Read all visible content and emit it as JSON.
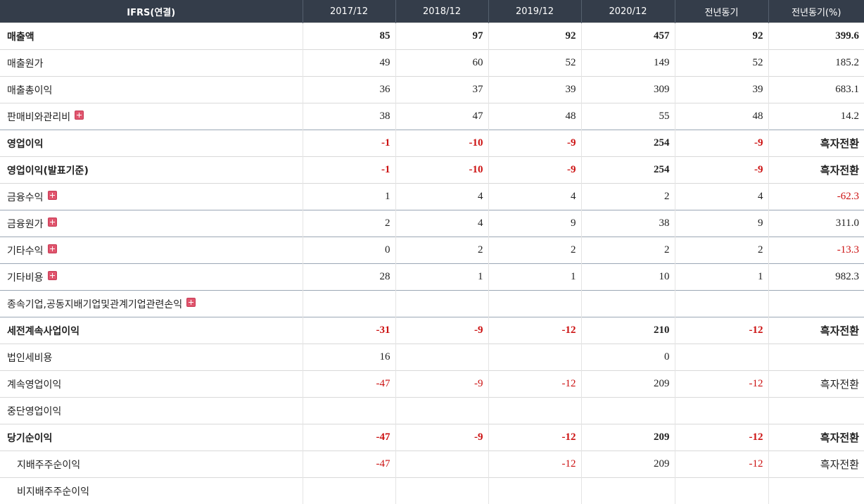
{
  "table": {
    "headers": [
      "IFRS(연결)",
      "2017/12",
      "2018/12",
      "2019/12",
      "2020/12",
      "전년동기",
      "전년동기(%)"
    ],
    "rows": [
      {
        "label": "매출액",
        "bold": true,
        "sub": false,
        "sep": false,
        "expand": false,
        "cells": [
          {
            "v": "85",
            "neg": false
          },
          {
            "v": "97",
            "neg": false
          },
          {
            "v": "92",
            "neg": false
          },
          {
            "v": "457",
            "neg": false
          },
          {
            "v": "92",
            "neg": false
          },
          {
            "v": "399.6",
            "neg": false
          }
        ]
      },
      {
        "label": "매출원가",
        "bold": false,
        "sub": false,
        "sep": false,
        "expand": false,
        "cells": [
          {
            "v": "49",
            "neg": false
          },
          {
            "v": "60",
            "neg": false
          },
          {
            "v": "52",
            "neg": false
          },
          {
            "v": "149",
            "neg": false
          },
          {
            "v": "52",
            "neg": false
          },
          {
            "v": "185.2",
            "neg": false
          }
        ]
      },
      {
        "label": "매출총이익",
        "bold": false,
        "sub": false,
        "sep": false,
        "expand": false,
        "cells": [
          {
            "v": "36",
            "neg": false
          },
          {
            "v": "37",
            "neg": false
          },
          {
            "v": "39",
            "neg": false
          },
          {
            "v": "309",
            "neg": false
          },
          {
            "v": "39",
            "neg": false
          },
          {
            "v": "683.1",
            "neg": false
          }
        ]
      },
      {
        "label": "판매비와관리비",
        "bold": false,
        "sub": false,
        "sep": false,
        "expand": true,
        "cells": [
          {
            "v": "38",
            "neg": false
          },
          {
            "v": "47",
            "neg": false
          },
          {
            "v": "48",
            "neg": false
          },
          {
            "v": "55",
            "neg": false
          },
          {
            "v": "48",
            "neg": false
          },
          {
            "v": "14.2",
            "neg": false
          }
        ]
      },
      {
        "label": "영업이익",
        "bold": true,
        "sub": false,
        "sep": true,
        "expand": false,
        "cells": [
          {
            "v": "-1",
            "neg": true
          },
          {
            "v": "-10",
            "neg": true
          },
          {
            "v": "-9",
            "neg": true
          },
          {
            "v": "254",
            "neg": false
          },
          {
            "v": "-9",
            "neg": true
          },
          {
            "v": "흑자전환",
            "neg": false
          }
        ]
      },
      {
        "label": "영업이익(발표기준)",
        "bold": true,
        "sub": false,
        "sep": false,
        "expand": false,
        "cells": [
          {
            "v": "-1",
            "neg": true
          },
          {
            "v": "-10",
            "neg": true
          },
          {
            "v": "-9",
            "neg": true
          },
          {
            "v": "254",
            "neg": false
          },
          {
            "v": "-9",
            "neg": true
          },
          {
            "v": "흑자전환",
            "neg": false
          }
        ]
      },
      {
        "label": "금융수익",
        "bold": false,
        "sub": false,
        "sep": false,
        "expand": true,
        "cells": [
          {
            "v": "1",
            "neg": false
          },
          {
            "v": "4",
            "neg": false
          },
          {
            "v": "4",
            "neg": false
          },
          {
            "v": "2",
            "neg": false
          },
          {
            "v": "4",
            "neg": false
          },
          {
            "v": "-62.3",
            "neg": true
          }
        ]
      },
      {
        "label": "금융원가",
        "bold": false,
        "sub": false,
        "sep": true,
        "expand": true,
        "cells": [
          {
            "v": "2",
            "neg": false
          },
          {
            "v": "4",
            "neg": false
          },
          {
            "v": "9",
            "neg": false
          },
          {
            "v": "38",
            "neg": false
          },
          {
            "v": "9",
            "neg": false
          },
          {
            "v": "311.0",
            "neg": false
          }
        ]
      },
      {
        "label": "기타수익",
        "bold": false,
        "sub": false,
        "sep": true,
        "expand": true,
        "cells": [
          {
            "v": "0",
            "neg": false
          },
          {
            "v": "2",
            "neg": false
          },
          {
            "v": "2",
            "neg": false
          },
          {
            "v": "2",
            "neg": false
          },
          {
            "v": "2",
            "neg": false
          },
          {
            "v": "-13.3",
            "neg": true
          }
        ]
      },
      {
        "label": "기타비용",
        "bold": false,
        "sub": false,
        "sep": true,
        "expand": true,
        "cells": [
          {
            "v": "28",
            "neg": false
          },
          {
            "v": "1",
            "neg": false
          },
          {
            "v": "1",
            "neg": false
          },
          {
            "v": "10",
            "neg": false
          },
          {
            "v": "1",
            "neg": false
          },
          {
            "v": "982.3",
            "neg": false
          }
        ]
      },
      {
        "label": "종속기업,공동지배기업및관계기업관련손익",
        "bold": false,
        "sub": false,
        "sep": true,
        "expand": true,
        "cells": [
          {
            "v": "",
            "neg": false
          },
          {
            "v": "",
            "neg": false
          },
          {
            "v": "",
            "neg": false
          },
          {
            "v": "",
            "neg": false
          },
          {
            "v": "",
            "neg": false
          },
          {
            "v": "",
            "neg": false
          }
        ]
      },
      {
        "label": "세전계속사업이익",
        "bold": true,
        "sub": false,
        "sep": true,
        "expand": false,
        "cells": [
          {
            "v": "-31",
            "neg": true
          },
          {
            "v": "-9",
            "neg": true
          },
          {
            "v": "-12",
            "neg": true
          },
          {
            "v": "210",
            "neg": false
          },
          {
            "v": "-12",
            "neg": true
          },
          {
            "v": "흑자전환",
            "neg": false
          }
        ]
      },
      {
        "label": "법인세비용",
        "bold": false,
        "sub": false,
        "sep": false,
        "expand": false,
        "cells": [
          {
            "v": "16",
            "neg": false
          },
          {
            "v": "",
            "neg": false
          },
          {
            "v": "",
            "neg": false
          },
          {
            "v": "0",
            "neg": false
          },
          {
            "v": "",
            "neg": false
          },
          {
            "v": "",
            "neg": false
          }
        ]
      },
      {
        "label": "계속영업이익",
        "bold": false,
        "sub": false,
        "sep": false,
        "expand": false,
        "cells": [
          {
            "v": "-47",
            "neg": true
          },
          {
            "v": "-9",
            "neg": true
          },
          {
            "v": "-12",
            "neg": true
          },
          {
            "v": "209",
            "neg": false
          },
          {
            "v": "-12",
            "neg": true
          },
          {
            "v": "흑자전환",
            "neg": false
          }
        ]
      },
      {
        "label": "중단영업이익",
        "bold": false,
        "sub": false,
        "sep": false,
        "expand": false,
        "cells": [
          {
            "v": "",
            "neg": false
          },
          {
            "v": "",
            "neg": false
          },
          {
            "v": "",
            "neg": false
          },
          {
            "v": "",
            "neg": false
          },
          {
            "v": "",
            "neg": false
          },
          {
            "v": "",
            "neg": false
          }
        ]
      },
      {
        "label": "당기순이익",
        "bold": true,
        "sub": false,
        "sep": false,
        "expand": false,
        "cells": [
          {
            "v": "-47",
            "neg": true
          },
          {
            "v": "-9",
            "neg": true
          },
          {
            "v": "-12",
            "neg": true
          },
          {
            "v": "209",
            "neg": false
          },
          {
            "v": "-12",
            "neg": true
          },
          {
            "v": "흑자전환",
            "neg": false
          }
        ]
      },
      {
        "label": "지배주주순이익",
        "bold": false,
        "sub": true,
        "sep": false,
        "expand": false,
        "cells": [
          {
            "v": "-47",
            "neg": true
          },
          {
            "v": "",
            "neg": false
          },
          {
            "v": "-12",
            "neg": true
          },
          {
            "v": "209",
            "neg": false
          },
          {
            "v": "-12",
            "neg": true
          },
          {
            "v": "흑자전환",
            "neg": false
          }
        ]
      },
      {
        "label": "비지배주주순이익",
        "bold": false,
        "sub": true,
        "sep": false,
        "expand": false,
        "cells": [
          {
            "v": "",
            "neg": false
          },
          {
            "v": "",
            "neg": false
          },
          {
            "v": "",
            "neg": false
          },
          {
            "v": "",
            "neg": false
          },
          {
            "v": "",
            "neg": false
          },
          {
            "v": "",
            "neg": false
          }
        ]
      }
    ]
  },
  "colors": {
    "header_bg": "#343d4a",
    "header_text": "#ffffff",
    "negative": "#cc1111",
    "expand_icon": "#e0556d"
  },
  "icons": {
    "expand": "plus-icon"
  }
}
